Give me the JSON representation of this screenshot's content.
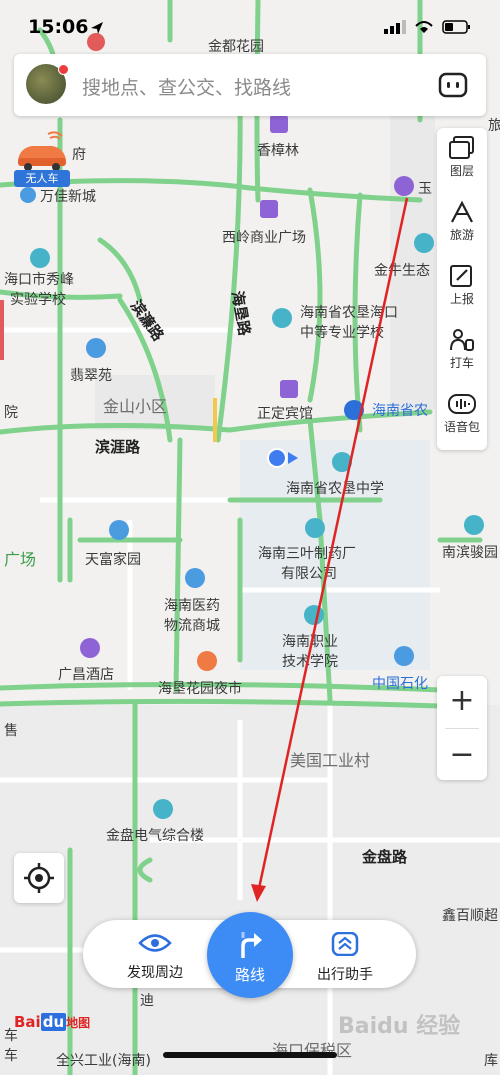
{
  "status": {
    "time": "15:06"
  },
  "search": {
    "placeholder": "搜地点、查公交、找路线"
  },
  "unmanned_badge": "无人车",
  "toolbar": {
    "items": [
      {
        "label": "图层"
      },
      {
        "label": "旅游"
      },
      {
        "label": "上报"
      },
      {
        "label": "打车"
      },
      {
        "label": "语音包"
      }
    ]
  },
  "zoom": {
    "in": "+",
    "out": "−"
  },
  "bottom_nav": {
    "left": "发现周边",
    "center": "路线",
    "right": "出行助手"
  },
  "baidu_logo": {
    "part1": "Bai",
    "part2": "du",
    "part3": "地图"
  },
  "watermark": "Baidu 经验",
  "map_labels": {
    "p1": "金都花园",
    "p2": "香樟林",
    "p3": "府",
    "p4": "万佳新城",
    "p5": "西岭商业广场",
    "p6": "玉",
    "p7": "旅",
    "p8": "金牛生态",
    "p9": "海口市秀峰",
    "p10": "实验学校",
    "p11": "滨濂路",
    "p12": "海垦路",
    "p13": "海南省农垦海口",
    "p14": "中等专业学校",
    "p15": "翡翠苑",
    "p16": "金山小区",
    "p17": "正定宾馆",
    "p18": "海南省农",
    "p19": "院",
    "p20": "滨涯路",
    "p21": "海南省农垦中学",
    "p22": "海南三叶制药厂",
    "p23": "有限公司",
    "p24": "天富家园",
    "p25": "广场",
    "p26": "南滨骏园",
    "p27": "海南医药",
    "p28": "物流商城",
    "p29": "海南职业",
    "p30": "技术学院",
    "p31": "广昌酒店",
    "p32": "海垦花园夜市",
    "p33": "中国石化",
    "p34": "售",
    "p35": "美国工业村",
    "p36": "金盘电气综合楼",
    "p37": "金盘路",
    "p38": "鑫百顺超",
    "p39": "迪",
    "p40": "车",
    "p41": "全兴工业(海南)",
    "p42": "海口保税区",
    "p43": "库",
    "p44": "车"
  },
  "colors": {
    "road": "#7fd18b",
    "accent": "#3d8cf5",
    "arrow": "#e02424",
    "poi_purple": "#8e63d6",
    "poi_blue": "#4b9be0",
    "poi_teal": "#47b3c9"
  }
}
